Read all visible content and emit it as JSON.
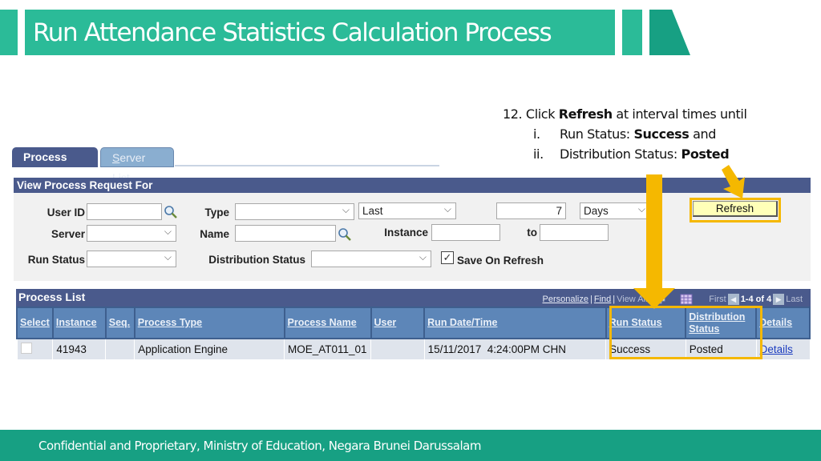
{
  "slide": {
    "title": "Run Attendance Statistics Calculation Process",
    "footer": "Confidential and Proprietary, Ministry of Education, Negara Brunei Darussalam",
    "colors": {
      "banner": "#2bbb98",
      "banner_dark": "#17a083",
      "highlight": "#f5b800"
    }
  },
  "instructions": {
    "step_prefix": "12. Click ",
    "step_bold": "Refresh",
    "step_suffix": " at interval times until",
    "items": [
      {
        "num": "i.",
        "text": "Run Status: ",
        "bold": "Success",
        "suffix": " and"
      },
      {
        "num": "ii.",
        "text": "Distribution Status: ",
        "bold": "Posted",
        "suffix": ""
      }
    ]
  },
  "tabs": [
    {
      "label": "Process List",
      "active": true
    },
    {
      "label_first": "S",
      "label_rest": "erver List",
      "active": false
    }
  ],
  "filter": {
    "header": "View Process Request For",
    "labels": {
      "user_id": "User ID",
      "type": "Type",
      "server": "Server",
      "name": "Name",
      "instance": "Instance",
      "to": "to",
      "run_status": "Run Status",
      "distribution_status": "Distribution Status",
      "save_on_refresh": "Save On Refresh"
    },
    "values": {
      "user_id": "",
      "type": "",
      "range": "Last",
      "range_count": "7",
      "range_unit": "Days",
      "server": "",
      "name": "",
      "instance_from": "",
      "instance_to": "",
      "run_status": "",
      "distribution_status": "",
      "save_on_refresh": true
    },
    "refresh_label": "Refresh"
  },
  "process_list": {
    "title": "Process List",
    "nav": {
      "personalize": "Personalize",
      "find": "Find",
      "view_all": "View All",
      "first": "First",
      "count": "1-4 of 4",
      "last": "Last"
    },
    "columns": [
      "Select",
      "Instance",
      "Seq.",
      "Process Type",
      "Process Name",
      "User",
      "Run Date/Time",
      "Run Status",
      "Distribution Status",
      "Details"
    ],
    "rows": [
      {
        "select": false,
        "instance": "41943",
        "seq": "",
        "process_type": "Application Engine",
        "process_name": "MOE_AT011_01",
        "user": "",
        "run_datetime": "15/11/2017  4:24:00PM CHN",
        "run_status": "Success",
        "distribution_status": "Posted",
        "details": "Details"
      }
    ]
  }
}
